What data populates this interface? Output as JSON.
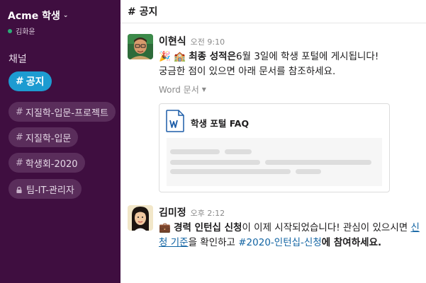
{
  "workspace": {
    "name": "Acme 학생",
    "user": "김화윤"
  },
  "sidebar": {
    "section_label": "채널",
    "channels": [
      {
        "label": "공지",
        "active": true
      },
      {
        "label": "지질학-입문-프로젝트",
        "active": false
      },
      {
        "label": "지질학-입문",
        "active": false
      },
      {
        "label": "학생회-2020",
        "active": false
      },
      {
        "label": "팀-IT-관리자",
        "active": false,
        "private": true
      }
    ]
  },
  "channel_header": {
    "title": "# 공지"
  },
  "messages": [
    {
      "author": "이현식",
      "time": "오전 9:10",
      "emoji": "🎉 🏫",
      "bold_lead": "최종 성적은",
      "text_rest": "6월 3일에 학생 포털에 게시됩니다!",
      "line2": "궁금한 점이 있으면 아래 문서를 참조하세요.",
      "attachment_label": "Word 문서",
      "file_title": "학생 포털 FAQ"
    },
    {
      "author": "김미정",
      "time": "오후 2:12",
      "emoji": "💼",
      "bold_lead": "경력 인턴십 신청",
      "text_mid": "이 이제 시작되었습니다! 관심이 있으시면 ",
      "link_text": "신청 기준",
      "text_after_link": "을 확인하고 ",
      "channel_link": "#2020-인턴십-신청",
      "bold_tail": "에 참여하세요."
    }
  ],
  "colors": {
    "sidebar_bg": "#3f0e40",
    "active_channel": "#1d9bd1",
    "link": "#1264a3",
    "online": "#2bac76"
  }
}
